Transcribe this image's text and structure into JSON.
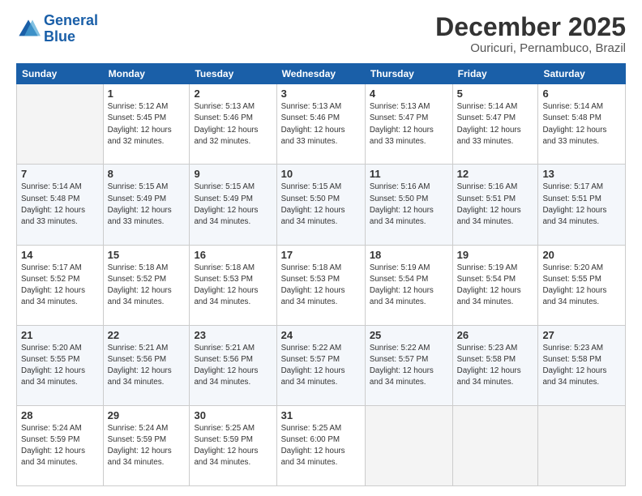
{
  "header": {
    "logo_line1": "General",
    "logo_line2": "Blue",
    "title": "December 2025",
    "subtitle": "Ouricuri, Pernambuco, Brazil"
  },
  "columns": [
    "Sunday",
    "Monday",
    "Tuesday",
    "Wednesday",
    "Thursday",
    "Friday",
    "Saturday"
  ],
  "weeks": [
    [
      {
        "date": "",
        "info": ""
      },
      {
        "date": "1",
        "info": "Sunrise: 5:12 AM\nSunset: 5:45 PM\nDaylight: 12 hours\nand 32 minutes."
      },
      {
        "date": "2",
        "info": "Sunrise: 5:13 AM\nSunset: 5:46 PM\nDaylight: 12 hours\nand 32 minutes."
      },
      {
        "date": "3",
        "info": "Sunrise: 5:13 AM\nSunset: 5:46 PM\nDaylight: 12 hours\nand 33 minutes."
      },
      {
        "date": "4",
        "info": "Sunrise: 5:13 AM\nSunset: 5:47 PM\nDaylight: 12 hours\nand 33 minutes."
      },
      {
        "date": "5",
        "info": "Sunrise: 5:14 AM\nSunset: 5:47 PM\nDaylight: 12 hours\nand 33 minutes."
      },
      {
        "date": "6",
        "info": "Sunrise: 5:14 AM\nSunset: 5:48 PM\nDaylight: 12 hours\nand 33 minutes."
      }
    ],
    [
      {
        "date": "7",
        "info": "Sunrise: 5:14 AM\nSunset: 5:48 PM\nDaylight: 12 hours\nand 33 minutes."
      },
      {
        "date": "8",
        "info": "Sunrise: 5:15 AM\nSunset: 5:49 PM\nDaylight: 12 hours\nand 33 minutes."
      },
      {
        "date": "9",
        "info": "Sunrise: 5:15 AM\nSunset: 5:49 PM\nDaylight: 12 hours\nand 34 minutes."
      },
      {
        "date": "10",
        "info": "Sunrise: 5:15 AM\nSunset: 5:50 PM\nDaylight: 12 hours\nand 34 minutes."
      },
      {
        "date": "11",
        "info": "Sunrise: 5:16 AM\nSunset: 5:50 PM\nDaylight: 12 hours\nand 34 minutes."
      },
      {
        "date": "12",
        "info": "Sunrise: 5:16 AM\nSunset: 5:51 PM\nDaylight: 12 hours\nand 34 minutes."
      },
      {
        "date": "13",
        "info": "Sunrise: 5:17 AM\nSunset: 5:51 PM\nDaylight: 12 hours\nand 34 minutes."
      }
    ],
    [
      {
        "date": "14",
        "info": "Sunrise: 5:17 AM\nSunset: 5:52 PM\nDaylight: 12 hours\nand 34 minutes."
      },
      {
        "date": "15",
        "info": "Sunrise: 5:18 AM\nSunset: 5:52 PM\nDaylight: 12 hours\nand 34 minutes."
      },
      {
        "date": "16",
        "info": "Sunrise: 5:18 AM\nSunset: 5:53 PM\nDaylight: 12 hours\nand 34 minutes."
      },
      {
        "date": "17",
        "info": "Sunrise: 5:18 AM\nSunset: 5:53 PM\nDaylight: 12 hours\nand 34 minutes."
      },
      {
        "date": "18",
        "info": "Sunrise: 5:19 AM\nSunset: 5:54 PM\nDaylight: 12 hours\nand 34 minutes."
      },
      {
        "date": "19",
        "info": "Sunrise: 5:19 AM\nSunset: 5:54 PM\nDaylight: 12 hours\nand 34 minutes."
      },
      {
        "date": "20",
        "info": "Sunrise: 5:20 AM\nSunset: 5:55 PM\nDaylight: 12 hours\nand 34 minutes."
      }
    ],
    [
      {
        "date": "21",
        "info": "Sunrise: 5:20 AM\nSunset: 5:55 PM\nDaylight: 12 hours\nand 34 minutes."
      },
      {
        "date": "22",
        "info": "Sunrise: 5:21 AM\nSunset: 5:56 PM\nDaylight: 12 hours\nand 34 minutes."
      },
      {
        "date": "23",
        "info": "Sunrise: 5:21 AM\nSunset: 5:56 PM\nDaylight: 12 hours\nand 34 minutes."
      },
      {
        "date": "24",
        "info": "Sunrise: 5:22 AM\nSunset: 5:57 PM\nDaylight: 12 hours\nand 34 minutes."
      },
      {
        "date": "25",
        "info": "Sunrise: 5:22 AM\nSunset: 5:57 PM\nDaylight: 12 hours\nand 34 minutes."
      },
      {
        "date": "26",
        "info": "Sunrise: 5:23 AM\nSunset: 5:58 PM\nDaylight: 12 hours\nand 34 minutes."
      },
      {
        "date": "27",
        "info": "Sunrise: 5:23 AM\nSunset: 5:58 PM\nDaylight: 12 hours\nand 34 minutes."
      }
    ],
    [
      {
        "date": "28",
        "info": "Sunrise: 5:24 AM\nSunset: 5:59 PM\nDaylight: 12 hours\nand 34 minutes."
      },
      {
        "date": "29",
        "info": "Sunrise: 5:24 AM\nSunset: 5:59 PM\nDaylight: 12 hours\nand 34 minutes."
      },
      {
        "date": "30",
        "info": "Sunrise: 5:25 AM\nSunset: 5:59 PM\nDaylight: 12 hours\nand 34 minutes."
      },
      {
        "date": "31",
        "info": "Sunrise: 5:25 AM\nSunset: 6:00 PM\nDaylight: 12 hours\nand 34 minutes."
      },
      {
        "date": "",
        "info": ""
      },
      {
        "date": "",
        "info": ""
      },
      {
        "date": "",
        "info": ""
      }
    ]
  ]
}
